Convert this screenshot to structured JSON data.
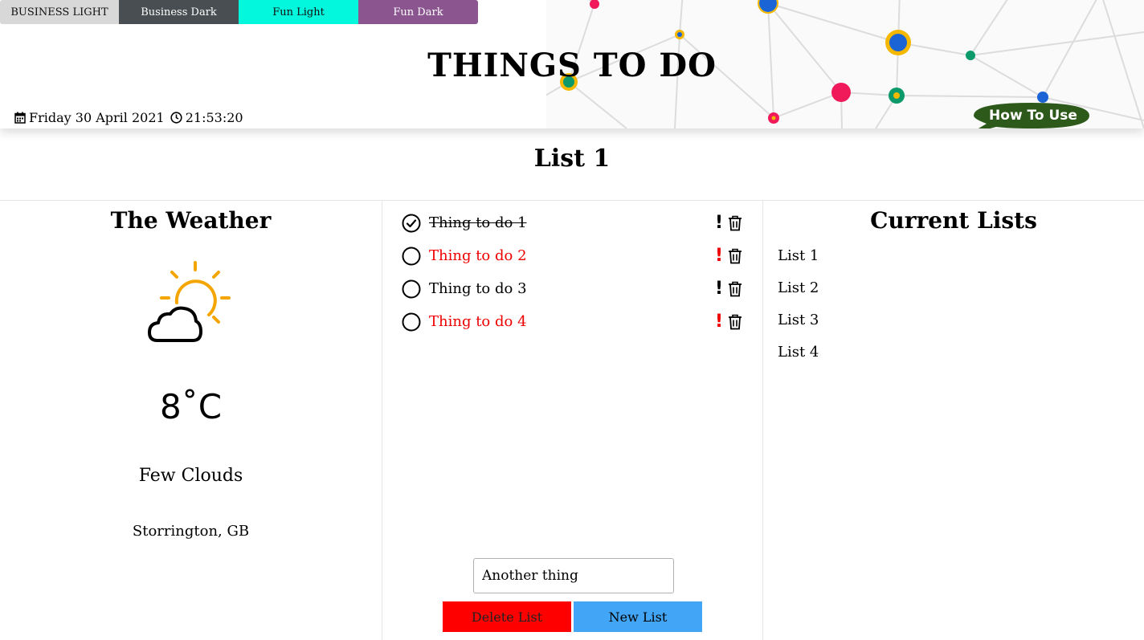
{
  "themes": [
    "BUSINESS LIGHT",
    "Business Dark",
    "Fun Light",
    "Fun Dark"
  ],
  "header": {
    "title": "THINGS TO DO",
    "date": "Friday 30 April 2021",
    "time": "21:53:20",
    "howto_label": "How To Use"
  },
  "list_title": "List 1",
  "weather": {
    "title": "The Weather",
    "icon": "few-clouds-icon",
    "temperature": "8˚C",
    "description": "Few Clouds",
    "location": "Storrington, GB"
  },
  "todos": [
    {
      "text": "Thing to do 1",
      "done": true,
      "urgent": false
    },
    {
      "text": "Thing to do 2",
      "done": false,
      "urgent": true
    },
    {
      "text": "Thing to do 3",
      "done": false,
      "urgent": false
    },
    {
      "text": "Thing to do 4",
      "done": false,
      "urgent": true
    }
  ],
  "new_item_value": "Another thing",
  "buttons": {
    "delete": "Delete List",
    "new": "New List"
  },
  "current_lists": {
    "title": "Current Lists",
    "items": [
      "List 1",
      "List 2",
      "List 3",
      "List 4"
    ]
  },
  "colors": {
    "urgent": "#ee0000",
    "delete": "#ff0000",
    "new": "#42a5f5",
    "howto": "#2d5a1b",
    "sun": "#f5a500"
  }
}
